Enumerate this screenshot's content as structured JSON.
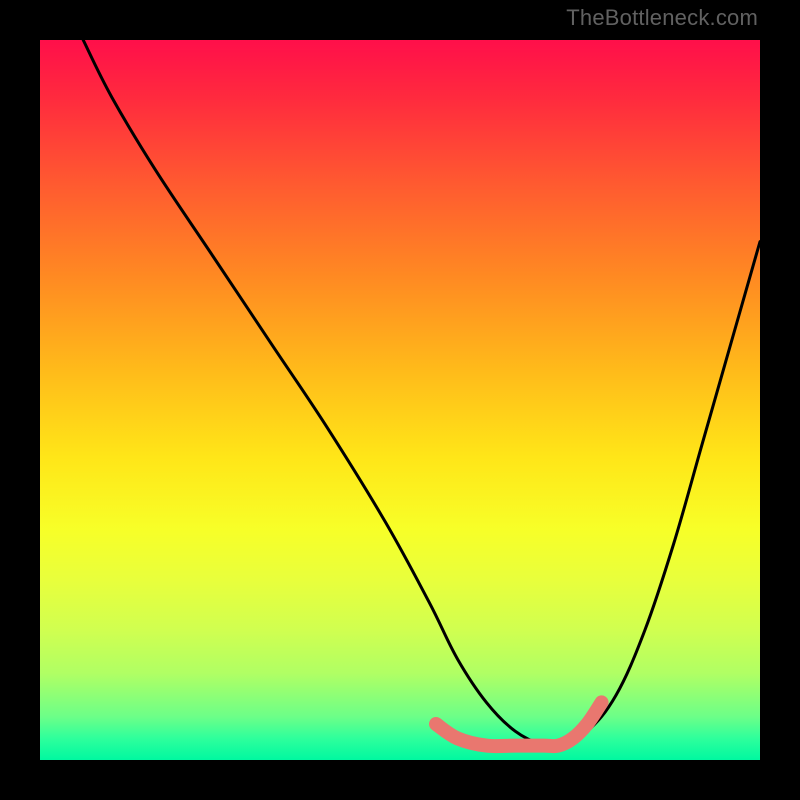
{
  "watermark": "TheBottleneck.com",
  "chart_data": {
    "type": "line",
    "title": "",
    "xlabel": "",
    "ylabel": "",
    "xlim": [
      0,
      100
    ],
    "ylim": [
      0,
      100
    ],
    "legend": false,
    "grid": false,
    "background_gradient": {
      "top": "#ff0f4a",
      "bottom": "#00f8a0",
      "stops": [
        "red",
        "orange",
        "yellow",
        "green"
      ]
    },
    "series": [
      {
        "name": "bottleneck-curve-black",
        "color": "#000000",
        "x": [
          6,
          10,
          16,
          24,
          32,
          40,
          48,
          54,
          58,
          62,
          66,
          70,
          72,
          76,
          80,
          84,
          88,
          92,
          96,
          100
        ],
        "y": [
          100,
          92,
          82,
          70,
          58,
          46,
          33,
          22,
          14,
          8,
          4,
          2,
          2,
          4,
          9,
          18,
          30,
          44,
          58,
          72
        ]
      },
      {
        "name": "bottleneck-floor-pink",
        "color": "#e9776f",
        "x": [
          55,
          58,
          62,
          66,
          70,
          72,
          74,
          76,
          78
        ],
        "y": [
          5,
          3,
          2,
          2,
          2,
          2,
          3,
          5,
          8
        ]
      }
    ],
    "annotations": []
  }
}
